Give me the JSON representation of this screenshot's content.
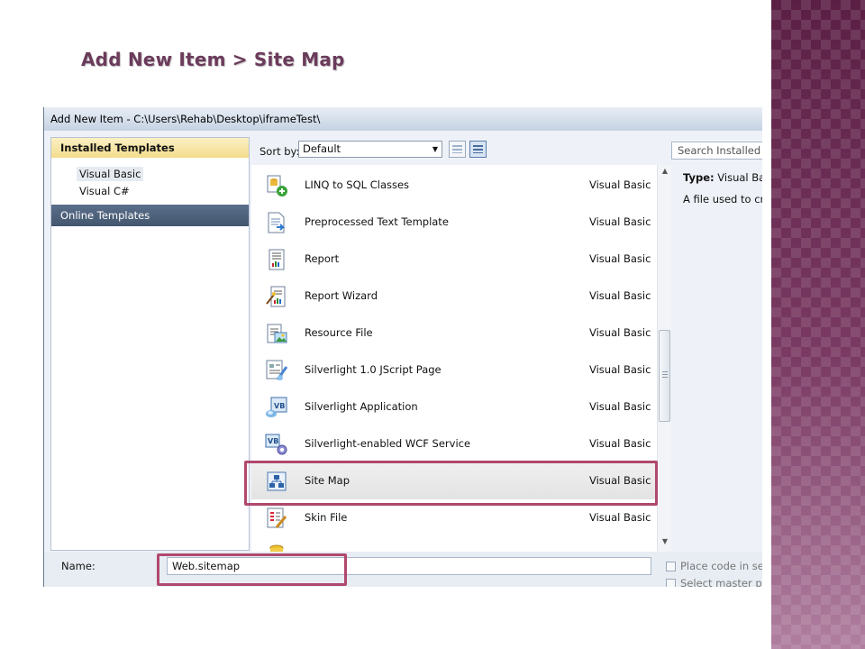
{
  "slide": {
    "title": "Add New Item > Site Map"
  },
  "dialog": {
    "title": "Add New Item - C:\\Users\\Rehab\\Desktop\\iframeTest\\",
    "left_pane": {
      "installed_header": "Installed Templates",
      "tree_items": [
        "Visual Basic",
        "Visual C#"
      ],
      "online_header": "Online Templates"
    },
    "sort": {
      "label": "Sort by:",
      "selected": "Default"
    },
    "search_placeholder": "Search Installed Te",
    "templates": [
      {
        "name": "LINQ to SQL Classes",
        "language": "Visual Basic",
        "icon": "linq-classes-icon"
      },
      {
        "name": "Preprocessed Text Template",
        "language": "Visual Basic",
        "icon": "text-template-icon"
      },
      {
        "name": "Report",
        "language": "Visual Basic",
        "icon": "report-icon"
      },
      {
        "name": "Report Wizard",
        "language": "Visual Basic",
        "icon": "report-wizard-icon"
      },
      {
        "name": "Resource File",
        "language": "Visual Basic",
        "icon": "resource-file-icon"
      },
      {
        "name": "Silverlight 1.0 JScript Page",
        "language": "Visual Basic",
        "icon": "jscript-page-icon"
      },
      {
        "name": "Silverlight Application",
        "language": "Visual Basic",
        "icon": "silverlight-app-icon"
      },
      {
        "name": "Silverlight-enabled WCF Service",
        "language": "Visual Basic",
        "icon": "wcf-service-icon"
      },
      {
        "name": "Site Map",
        "language": "Visual Basic",
        "icon": "site-map-icon",
        "selected": true
      },
      {
        "name": "Skin File",
        "language": "Visual Basic",
        "icon": "skin-file-icon"
      }
    ],
    "details": {
      "type_label": "Type:",
      "type_value": "Visual Bas",
      "description": "A file used to cre"
    },
    "name_label": "Name:",
    "name_value": "Web.sitemap",
    "options": [
      "Place code in sep",
      "Select master pag"
    ],
    "highlight_color": "#b0486d"
  }
}
